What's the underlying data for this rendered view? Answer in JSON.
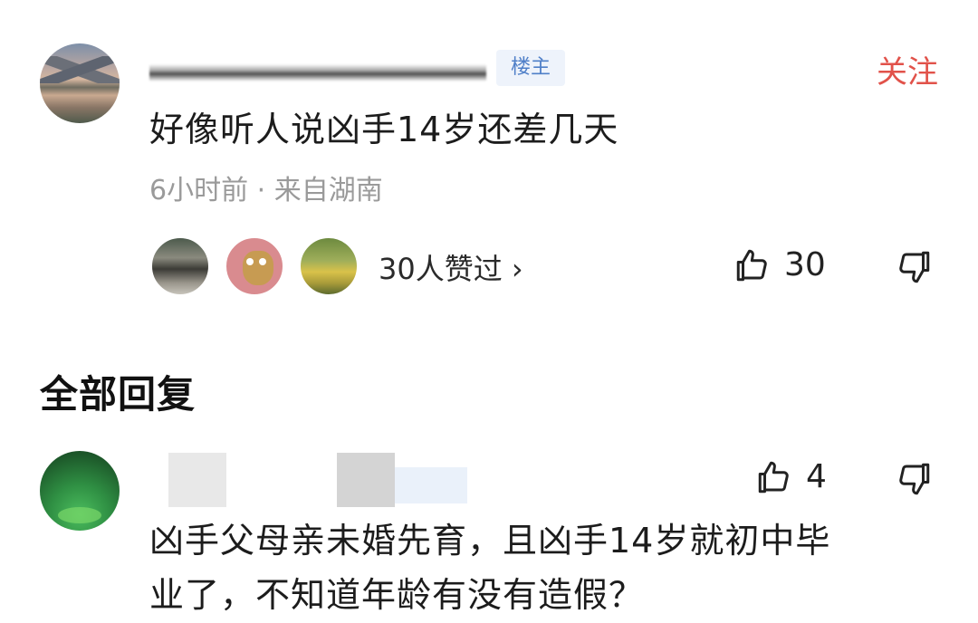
{
  "main_comment": {
    "badge": "楼主",
    "follow_label": "关注",
    "text": "好像听人说凶手14岁还差几天",
    "meta": "6小时前 · 来自湖南",
    "likers_label": "30人赞过 ›",
    "like_count": "30"
  },
  "section": {
    "title": "全部回复"
  },
  "reply": {
    "like_count": "4",
    "text_line1": "凶手父母亲未婚先育，且凶手14岁就初中毕",
    "text_line2": "业了，不知道年龄有没有造假？"
  },
  "icons": {
    "like": "thumbs-up-icon",
    "dislike": "thumbs-down-icon"
  },
  "colors": {
    "follow": "#e1524a",
    "badge_text": "#4f7fc8",
    "badge_bg": "#eef3fb",
    "meta": "#9a9a9a"
  }
}
